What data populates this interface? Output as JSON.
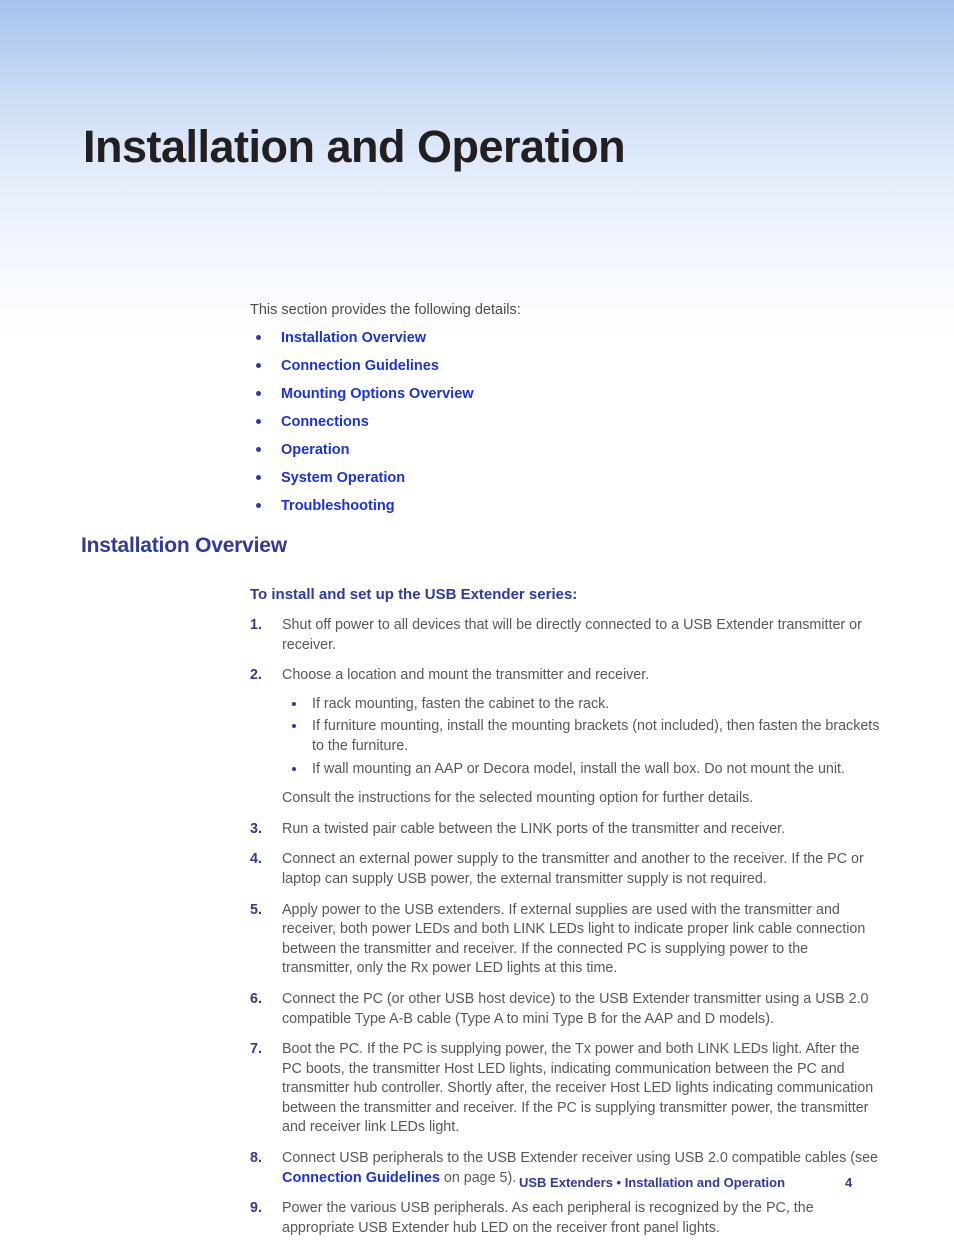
{
  "document": {
    "title": "Installation and Operation",
    "intro": "This section provides the following details:"
  },
  "colors": {
    "link_blue": "#1a33d6",
    "heading_navy": "#2e3b9c",
    "body_gray": "#58585b",
    "title_black": "#231f20",
    "gradient_top": "#a7c3ed"
  },
  "toc_links": [
    {
      "label": "Installation Overview"
    },
    {
      "label": "Connection Guidelines"
    },
    {
      "label": "Mounting Options Overview"
    },
    {
      "label": "Connections"
    },
    {
      "label": "Operation"
    },
    {
      "label": "System Operation"
    },
    {
      "label": "Troubleshooting"
    }
  ],
  "section": {
    "heading": "Installation Overview",
    "sub_heading": "To install and set up the USB Extender series:"
  },
  "steps": [
    {
      "num": "1.",
      "text": "Shut off power to all devices that will be directly connected to a USB Extender transmitter or receiver."
    },
    {
      "num": "2.",
      "text": "Choose a location and mount the transmitter and receiver.",
      "sub_bullets": [
        "If rack mounting, fasten the cabinet to the rack.",
        "If furniture mounting, install the mounting brackets (not included), then fasten the brackets to the furniture.",
        "If wall mounting an AAP or Decora model, install the wall box. Do not mount the unit."
      ],
      "trailing_note": "Consult the instructions for the selected mounting option for further details."
    },
    {
      "num": "3.",
      "text": "Run a twisted pair cable between the LINK ports of the transmitter and receiver."
    },
    {
      "num": "4.",
      "text": "Connect an external power supply to the transmitter and another to the receiver. If the PC or laptop can supply USB power, the external transmitter supply is not required."
    },
    {
      "num": "5.",
      "text": "Apply power to the USB extenders. If external supplies are used with the transmitter and receiver, both power LEDs and both LINK LEDs light to indicate proper link cable connection between the transmitter and receiver. If the connected PC is supplying power to the transmitter, only the Rx power LED lights at this time."
    },
    {
      "num": "6.",
      "text": "Connect the PC (or other USB host device) to the USB Extender transmitter using a USB 2.0 compatible Type A-B cable (Type A to mini Type B for the AAP and D models)."
    },
    {
      "num": "7.",
      "text": "Boot the PC. If the PC is supplying power, the Tx power and both LINK LEDs light. After the PC boots, the transmitter Host LED lights, indicating communication between the PC and transmitter hub controller. Shortly after, the receiver Host LED lights indicating communication between the transmitter and receiver. If the PC is supplying transmitter power, the transmitter and receiver link LEDs light."
    },
    {
      "num": "8.",
      "text_before": "Connect USB peripherals to the USB Extender receiver using USB 2.0 compatible cables (see ",
      "link": "Connection Guidelines",
      "text_after": " on page 5)."
    },
    {
      "num": "9.",
      "text": "Power the various USB peripherals. As each peripheral is recognized by the PC, the appropriate USB Extender hub LED on the receiver front panel lights."
    }
  ],
  "footer": {
    "text": "USB Extenders • Installation and Operation",
    "page_number": "4"
  }
}
